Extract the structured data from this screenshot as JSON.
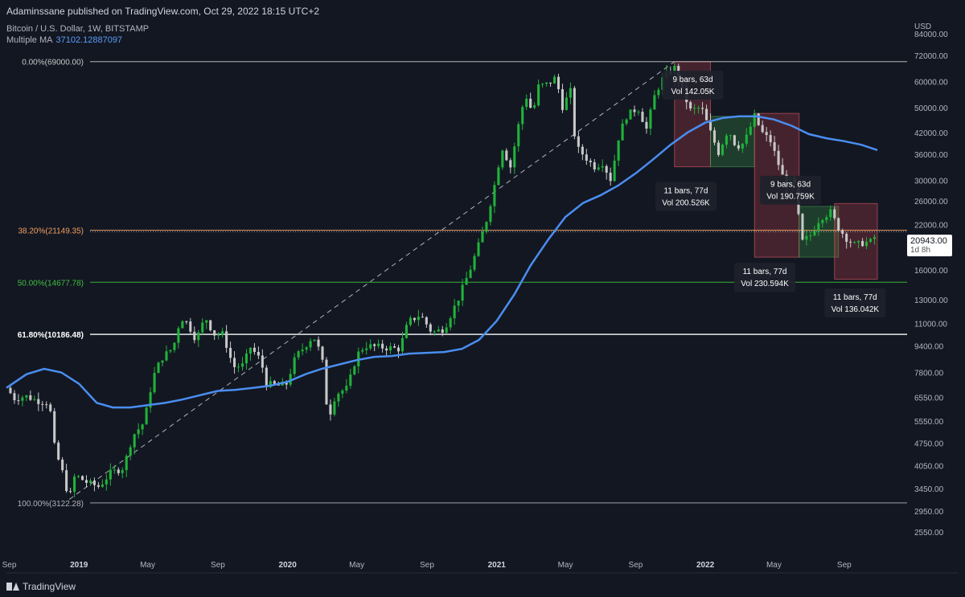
{
  "header": {
    "publisher": "Adaminssane published on TradingView.com, Oct 29, 2022 18:15 UTC+2",
    "symbol": "Bitcoin / U.S. Dollar, 1W, BITSTAMP",
    "ma_label": "Multiple MA",
    "ma_value": "37102.12887097"
  },
  "footer": {
    "brand": "TradingView"
  },
  "price_tag": {
    "value": "20943.00",
    "time": "1d 8h"
  },
  "colors": {
    "background": "#131722",
    "up": "#26a69a",
    "up_body": "#1fb33a",
    "down": "#c8c8c8",
    "ma": "#4a8ef0",
    "fib_orange": "#f0a060",
    "fib_green": "#3fbf3f",
    "fib_white": "#ffffff",
    "fib_grey": "#8a8e99",
    "red_box": "rgba(200,70,80,0.28)",
    "green_box": "rgba(60,150,70,0.30)"
  },
  "chart_data": {
    "type": "candlestick",
    "axis_currency": "USD",
    "scale": "log",
    "ylim": [
      2200,
      95000
    ],
    "y_ticks": [
      84000,
      72000,
      60000,
      50000,
      42000,
      36000,
      30000,
      26000,
      22000,
      16000,
      13000,
      11000,
      9400,
      7800,
      6550,
      5550,
      4750,
      4050,
      3450,
      2950,
      2550
    ],
    "y_tick_labels": [
      "84000.00",
      "72000.00",
      "60000.00",
      "50000.00",
      "42000.00",
      "36000.00",
      "30000.00",
      "26000.00",
      "22000.00",
      "16000.00",
      "13000.00",
      "11000.00",
      "9400.00",
      "7800.00",
      "6550.00",
      "5550.00",
      "4750.00",
      "4050.00",
      "3450.00",
      "2950.00",
      "2550.00"
    ],
    "x_start": "2018-08-27",
    "x_end": "2022-12-20",
    "x_ticks": [
      {
        "label": "Sep",
        "date": "2018-09-01",
        "bold": false
      },
      {
        "label": "2019",
        "date": "2019-01-01",
        "bold": true
      },
      {
        "label": "May",
        "date": "2019-05-01",
        "bold": false
      },
      {
        "label": "Sep",
        "date": "2019-09-01",
        "bold": false
      },
      {
        "label": "2020",
        "date": "2020-01-01",
        "bold": true
      },
      {
        "label": "May",
        "date": "2020-05-01",
        "bold": false
      },
      {
        "label": "Sep",
        "date": "2020-09-01",
        "bold": false
      },
      {
        "label": "2021",
        "date": "2021-01-01",
        "bold": true
      },
      {
        "label": "May",
        "date": "2021-05-01",
        "bold": false
      },
      {
        "label": "Sep",
        "date": "2021-09-01",
        "bold": false
      },
      {
        "label": "2022",
        "date": "2022-01-01",
        "bold": true
      },
      {
        "label": "May",
        "date": "2022-05-01",
        "bold": false
      },
      {
        "label": "Sep",
        "date": "2022-09-01",
        "bold": false
      }
    ],
    "close_path": [
      [
        "2018-08-27",
        7000
      ],
      [
        "2018-09-10",
        6500
      ],
      [
        "2018-09-30",
        6600
      ],
      [
        "2018-10-20",
        6400
      ],
      [
        "2018-11-10",
        6300
      ],
      [
        "2018-11-20",
        4500
      ],
      [
        "2018-12-01",
        4000
      ],
      [
        "2018-12-15",
        3200
      ],
      [
        "2018-12-25",
        3800
      ],
      [
        "2019-01-15",
        3600
      ],
      [
        "2019-02-05",
        3500
      ],
      [
        "2019-02-25",
        3850
      ],
      [
        "2019-03-20",
        4000
      ],
      [
        "2019-04-05",
        5000
      ],
      [
        "2019-04-25",
        5500
      ],
      [
        "2019-05-10",
        7500
      ],
      [
        "2019-05-25",
        8600
      ],
      [
        "2019-06-15",
        9300
      ],
      [
        "2019-06-28",
        11500
      ],
      [
        "2019-07-10",
        11000
      ],
      [
        "2019-07-25",
        9800
      ],
      [
        "2019-08-10",
        11500
      ],
      [
        "2019-08-25",
        10200
      ],
      [
        "2019-09-10",
        10200
      ],
      [
        "2019-09-28",
        8100
      ],
      [
        "2019-10-15",
        8200
      ],
      [
        "2019-10-28",
        9300
      ],
      [
        "2019-11-15",
        8500
      ],
      [
        "2019-11-25",
        7200
      ],
      [
        "2019-12-15",
        7100
      ],
      [
        "2019-12-30",
        7200
      ],
      [
        "2020-01-15",
        8700
      ],
      [
        "2020-02-01",
        9400
      ],
      [
        "2020-02-15",
        10100
      ],
      [
        "2020-03-01",
        8700
      ],
      [
        "2020-03-12",
        5600
      ],
      [
        "2020-03-25",
        6700
      ],
      [
        "2020-04-15",
        7000
      ],
      [
        "2020-05-01",
        8800
      ],
      [
        "2020-05-15",
        9400
      ],
      [
        "2020-06-15",
        9300
      ],
      [
        "2020-07-15",
        9200
      ],
      [
        "2020-07-30",
        11100
      ],
      [
        "2020-08-20",
        11700
      ],
      [
        "2020-09-10",
        10300
      ],
      [
        "2020-10-01",
        10600
      ],
      [
        "2020-10-25",
        13000
      ],
      [
        "2020-11-15",
        16000
      ],
      [
        "2020-11-30",
        19000
      ],
      [
        "2020-12-15",
        23000
      ],
      [
        "2020-12-28",
        29000
      ],
      [
        "2021-01-10",
        38000
      ],
      [
        "2021-01-25",
        33000
      ],
      [
        "2021-02-10",
        46000
      ],
      [
        "2021-02-20",
        55000
      ],
      [
        "2021-03-05",
        48000
      ],
      [
        "2021-03-15",
        58000
      ],
      [
        "2021-04-01",
        59000
      ],
      [
        "2021-04-15",
        62000
      ],
      [
        "2021-04-25",
        50000
      ],
      [
        "2021-05-10",
        56000
      ],
      [
        "2021-05-19",
        38000
      ],
      [
        "2021-06-01",
        36000
      ],
      [
        "2021-06-20",
        33000
      ],
      [
        "2021-07-05",
        34000
      ],
      [
        "2021-07-20",
        30000
      ],
      [
        "2021-08-01",
        40000
      ],
      [
        "2021-08-15",
        47000
      ],
      [
        "2021-09-05",
        50000
      ],
      [
        "2021-09-20",
        43000
      ],
      [
        "2021-10-05",
        55000
      ],
      [
        "2021-10-20",
        62000
      ],
      [
        "2021-11-08",
        66000
      ],
      [
        "2021-11-20",
        58000
      ],
      [
        "2021-12-05",
        49000
      ],
      [
        "2021-12-25",
        50000
      ],
      [
        "2022-01-10",
        42000
      ],
      [
        "2022-01-24",
        36500
      ],
      [
        "2022-02-10",
        43000
      ],
      [
        "2022-02-24",
        38000
      ],
      [
        "2022-03-10",
        39000
      ],
      [
        "2022-03-28",
        47000
      ],
      [
        "2022-04-10",
        42000
      ],
      [
        "2022-04-25",
        39500
      ],
      [
        "2022-05-08",
        34000
      ],
      [
        "2022-05-20",
        29500
      ],
      [
        "2022-06-05",
        30000
      ],
      [
        "2022-06-14",
        22500
      ],
      [
        "2022-06-20",
        19500
      ],
      [
        "2022-07-05",
        20500
      ],
      [
        "2022-07-20",
        23000
      ],
      [
        "2022-08-08",
        24000
      ],
      [
        "2022-08-22",
        21500
      ],
      [
        "2022-09-05",
        20000
      ],
      [
        "2022-09-20",
        19000
      ],
      [
        "2022-10-05",
        19400
      ],
      [
        "2022-10-20",
        19500
      ],
      [
        "2022-10-29",
        20943
      ]
    ],
    "ma_series": [
      [
        "2018-08-27",
        7000
      ],
      [
        "2018-10-01",
        7700
      ],
      [
        "2018-11-01",
        8000
      ],
      [
        "2018-12-01",
        7800
      ],
      [
        "2019-01-01",
        7200
      ],
      [
        "2019-02-01",
        6300
      ],
      [
        "2019-03-01",
        6100
      ],
      [
        "2019-04-01",
        6100
      ],
      [
        "2019-05-01",
        6200
      ],
      [
        "2019-06-01",
        6300
      ],
      [
        "2019-07-01",
        6450
      ],
      [
        "2019-08-01",
        6650
      ],
      [
        "2019-09-01",
        6850
      ],
      [
        "2019-10-01",
        6900
      ],
      [
        "2019-11-01",
        7000
      ],
      [
        "2019-12-01",
        7100
      ],
      [
        "2020-01-01",
        7300
      ],
      [
        "2020-02-01",
        7700
      ],
      [
        "2020-03-01",
        8000
      ],
      [
        "2020-04-01",
        8250
      ],
      [
        "2020-05-01",
        8500
      ],
      [
        "2020-06-01",
        8700
      ],
      [
        "2020-07-01",
        8750
      ],
      [
        "2020-08-01",
        8900
      ],
      [
        "2020-09-01",
        8950
      ],
      [
        "2020-10-01",
        9000
      ],
      [
        "2020-11-01",
        9200
      ],
      [
        "2020-12-01",
        9800
      ],
      [
        "2021-01-01",
        11200
      ],
      [
        "2021-02-01",
        13500
      ],
      [
        "2021-03-01",
        16500
      ],
      [
        "2021-04-01",
        19800
      ],
      [
        "2021-05-01",
        23200
      ],
      [
        "2021-06-01",
        25600
      ],
      [
        "2021-07-01",
        27000
      ],
      [
        "2021-08-01",
        28900
      ],
      [
        "2021-09-01",
        31500
      ],
      [
        "2021-10-01",
        34700
      ],
      [
        "2021-11-01",
        38500
      ],
      [
        "2021-12-01",
        42000
      ],
      [
        "2022-01-01",
        45000
      ],
      [
        "2022-02-01",
        46500
      ],
      [
        "2022-03-01",
        47000
      ],
      [
        "2022-04-01",
        47000
      ],
      [
        "2022-05-01",
        46000
      ],
      [
        "2022-06-01",
        44000
      ],
      [
        "2022-07-01",
        41500
      ],
      [
        "2022-08-01",
        40300
      ],
      [
        "2022-09-01",
        39500
      ],
      [
        "2022-10-01",
        38500
      ],
      [
        "2022-10-29",
        37100
      ]
    ],
    "fib_levels": [
      {
        "label": "0.00%(69000.00)",
        "price": 69000,
        "color": "#c8c8c8",
        "bold": false
      },
      {
        "label": "38.20%(21149.35)",
        "price": 21149.35,
        "color": "#f0a060",
        "bold": false
      },
      {
        "label": "50.00%(14677.78)",
        "price": 14677.78,
        "color": "#3fbf3f",
        "bold": false
      },
      {
        "label": "61.80%(10186.48)",
        "price": 10186.48,
        "color": "#ffffff",
        "bold": true
      },
      {
        "label": "100.00%(3122.28)",
        "price": 3122.28,
        "color": "#b0b3bb",
        "bold": false
      }
    ],
    "trendline": {
      "from": [
        "2018-12-15",
        3200
      ],
      "to": [
        "2021-11-08",
        69000
      ]
    },
    "boxes": [
      {
        "start": "2021-11-08",
        "end": "2022-01-10",
        "top": 69000,
        "bottom": 33000,
        "kind": "red"
      },
      {
        "start": "2022-01-10",
        "end": "2022-03-28",
        "top": 47000,
        "bottom": 33000,
        "kind": "green"
      },
      {
        "start": "2022-03-28",
        "end": "2022-06-14",
        "top": 48000,
        "bottom": 17500,
        "kind": "red"
      },
      {
        "start": "2022-06-14",
        "end": "2022-08-22",
        "top": 25000,
        "bottom": 17500,
        "kind": "green"
      },
      {
        "start": "2022-08-15",
        "end": "2022-10-29",
        "top": 25500,
        "bottom": 15000,
        "kind": "red"
      }
    ],
    "annotations": [
      {
        "lines": [
          "9 bars, 63d",
          "Vol 142.05K"
        ],
        "date": "2021-12-10",
        "price": 58500
      },
      {
        "lines": [
          "11 bars, 77d",
          "Vol 200.526K"
        ],
        "date": "2021-11-28",
        "price": 26800
      },
      {
        "lines": [
          "9 bars, 63d",
          "Vol 190.759K"
        ],
        "date": "2022-05-30",
        "price": 28000
      },
      {
        "lines": [
          "11 bars, 77d",
          "Vol 230.594K"
        ],
        "date": "2022-04-15",
        "price": 15200
      },
      {
        "lines": [
          "11 bars, 77d",
          "Vol 136.042K"
        ],
        "date": "2022-09-20",
        "price": 12700
      }
    ]
  }
}
